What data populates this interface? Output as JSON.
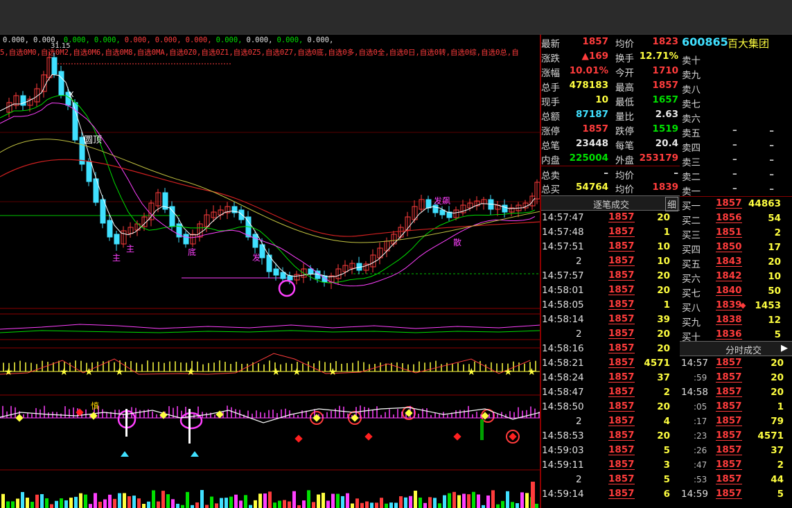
{
  "indicator_row1": [
    "0.000,",
    "0.000,",
    "0.000,",
    "0.000,",
    "0.000,",
    "0.000,",
    "0.000,",
    "0.000,",
    "0.000,",
    "0.000,",
    "0.000,"
  ],
  "indicator_row2": "5,自选0M0,自选0M2,自选0M6,自选0M8,自选0MA,自选0Z0,自选0Z1,自选0Z5,自选0Z7,自选0底,自选0多,自选0全,自选0日,自选0转,自选0综,自选0总,自",
  "price_label_high": "31.15",
  "chart_labels": {
    "yuanding": "圆顶",
    "x_mark": "X",
    "fa_ban": "发飙",
    "san": "散",
    "zhen": "慎",
    "zhu1": "主",
    "zhu2": "主",
    "di": "底",
    "fa": "发"
  },
  "quote": {
    "rows": [
      {
        "l1": "最新",
        "v1": "1857",
        "c1": "red",
        "l2": "均价",
        "v2": "1823",
        "c2": "red"
      },
      {
        "l1": "涨跌",
        "v1": "▲169",
        "c1": "red",
        "l2": "换手",
        "v2": "12.71%",
        "c2": "yellow"
      },
      {
        "l1": "涨幅",
        "v1": "10.01%",
        "c1": "red",
        "l2": "今开",
        "v2": "1710",
        "c2": "red"
      },
      {
        "l1": "总手",
        "v1": "478183",
        "c1": "yellow",
        "l2": "最高",
        "v2": "1857",
        "c2": "red"
      },
      {
        "l1": "现手",
        "v1": "10",
        "c1": "yellow",
        "l2": "最低",
        "v2": "1657",
        "c2": "green"
      },
      {
        "l1": "总额",
        "v1": "87187",
        "c1": "cyan",
        "l2": "量比",
        "v2": "2.63",
        "c2": "white"
      },
      {
        "l1": "涨停",
        "v1": "1857",
        "c1": "red",
        "l2": "跌停",
        "v2": "1519",
        "c2": "green"
      },
      {
        "l1": "总笔",
        "v1": "23448",
        "c1": "white",
        "l2": "每笔",
        "v2": "20.4",
        "c2": "white"
      },
      {
        "l1": "内盘",
        "v1": "225004",
        "c1": "green",
        "l2": "外盘",
        "v2": "253179",
        "c2": "red"
      },
      {
        "l1": "总卖",
        "v1": "–",
        "c1": "white",
        "l2": "均价",
        "v2": "–",
        "c2": "white"
      },
      {
        "l1": "总买",
        "v1": "54764",
        "c1": "yellow",
        "l2": "均价",
        "v2": "1839",
        "c2": "red"
      }
    ]
  },
  "trades_tab": {
    "label": "逐笔成交",
    "detail": "细"
  },
  "trades": [
    {
      "t": "14:57:47",
      "p": "1857",
      "v": "20"
    },
    {
      "t": "14:57:48",
      "p": "1857",
      "v": "1"
    },
    {
      "t": "14:57:51",
      "p": "1857",
      "v": "10"
    },
    {
      "t": "2",
      "p": "1857",
      "v": "10"
    },
    {
      "t": "14:57:57",
      "p": "1857",
      "v": "20"
    },
    {
      "t": "14:58:01",
      "p": "1857",
      "v": "20"
    },
    {
      "t": "14:58:05",
      "p": "1857",
      "v": "1"
    },
    {
      "t": "14:58:14",
      "p": "1857",
      "v": "39"
    },
    {
      "t": "2",
      "p": "1857",
      "v": "20"
    },
    {
      "t": "14:58:16",
      "p": "1857",
      "v": "20"
    },
    {
      "t": "14:58:21",
      "p": "1857",
      "v": "4571"
    },
    {
      "t": "14:58:24",
      "p": "1857",
      "v": "37"
    },
    {
      "t": "14:58:47",
      "p": "1857",
      "v": "2"
    },
    {
      "t": "14:58:50",
      "p": "1857",
      "v": "20"
    },
    {
      "t": "2",
      "p": "1857",
      "v": "4"
    },
    {
      "t": "14:58:53",
      "p": "1857",
      "v": "20"
    },
    {
      "t": "14:59:03",
      "p": "1857",
      "v": "5"
    },
    {
      "t": "14:59:11",
      "p": "1857",
      "v": "3"
    },
    {
      "t": "2",
      "p": "1857",
      "v": "5"
    },
    {
      "t": "14:59:14",
      "p": "1857",
      "v": "6"
    }
  ],
  "stock": {
    "code": "600865",
    "name": "百大集团"
  },
  "orderbook": {
    "sell": [
      {
        "l": "卖十",
        "p": "",
        "v": ""
      },
      {
        "l": "卖九",
        "p": "",
        "v": ""
      },
      {
        "l": "卖八",
        "p": "",
        "v": ""
      },
      {
        "l": "卖七",
        "p": "",
        "v": ""
      },
      {
        "l": "卖六",
        "p": "",
        "v": ""
      },
      {
        "l": "卖五",
        "p": "–",
        "v": "–"
      },
      {
        "l": "卖四",
        "p": "–",
        "v": "–"
      },
      {
        "l": "卖三",
        "p": "–",
        "v": "–"
      },
      {
        "l": "卖二",
        "p": "–",
        "v": "–"
      },
      {
        "l": "卖一",
        "p": "–",
        "v": "–"
      }
    ],
    "buy": [
      {
        "l": "买一",
        "p": "1857",
        "v": "44863"
      },
      {
        "l": "买二",
        "p": "1856",
        "v": "54"
      },
      {
        "l": "买三",
        "p": "1851",
        "v": "2"
      },
      {
        "l": "买四",
        "p": "1850",
        "v": "17"
      },
      {
        "l": "买五",
        "p": "1843",
        "v": "20"
      },
      {
        "l": "买六",
        "p": "1842",
        "v": "10"
      },
      {
        "l": "买七",
        "p": "1840",
        "v": "50"
      },
      {
        "l": "买八",
        "p": "1839",
        "v": "1453"
      },
      {
        "l": "买九",
        "p": "1838",
        "v": "12"
      },
      {
        "l": "买十",
        "p": "1836",
        "v": "5"
      }
    ]
  },
  "ticks_tab": {
    "label": "分时成交",
    "arrow": "▶"
  },
  "ticks": [
    {
      "t": "14:57",
      "sub": false,
      "p": "1857",
      "v": "20"
    },
    {
      "t": ":59",
      "sub": true,
      "p": "1857",
      "v": "20"
    },
    {
      "t": "14:58",
      "sub": false,
      "p": "1857",
      "v": "20"
    },
    {
      "t": ":05",
      "sub": true,
      "p": "1857",
      "v": "1"
    },
    {
      "t": ":17",
      "sub": true,
      "p": "1857",
      "v": "79"
    },
    {
      "t": ":23",
      "sub": true,
      "p": "1857",
      "v": "4571"
    },
    {
      "t": ":26",
      "sub": true,
      "p": "1857",
      "v": "37"
    },
    {
      "t": ":47",
      "sub": true,
      "p": "1857",
      "v": "2"
    },
    {
      "t": ":53",
      "sub": true,
      "p": "1857",
      "v": "44"
    },
    {
      "t": "14:59",
      "sub": false,
      "p": "1857",
      "v": "5"
    }
  ],
  "colors": {
    "red": "#ff3c3c",
    "green": "#00e000",
    "yellow": "#ffff40",
    "cyan": "#40e0ff",
    "magenta": "#ff40ff",
    "divider": "#8b0000"
  }
}
